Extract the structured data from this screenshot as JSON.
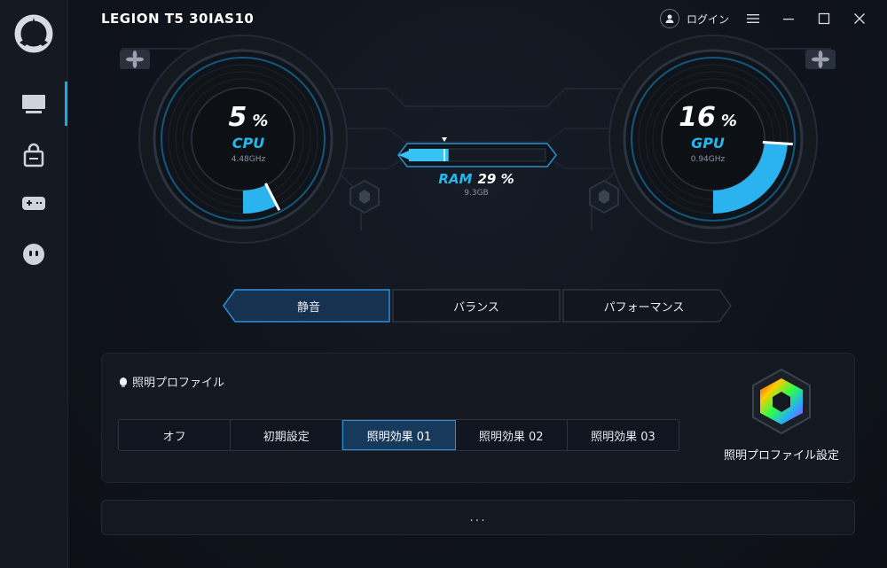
{
  "app": {
    "title": "LEGION T5 30IAS10"
  },
  "topbar": {
    "login_label": "ログイン"
  },
  "gauges": {
    "cpu": {
      "value": "5",
      "unit": "%",
      "label": "CPU",
      "freq": "4.48GHz",
      "percent": 5
    },
    "gpu": {
      "value": "16",
      "unit": "%",
      "label": "GPU",
      "freq": "0.94GHz",
      "percent": 16
    },
    "ram": {
      "label": "RAM",
      "value": "29 %",
      "size": "9.3GB",
      "percent": 29
    }
  },
  "modes": {
    "items": [
      "静音",
      "バランス",
      "パフォーマンス"
    ],
    "selected": "静音"
  },
  "lighting": {
    "title": "照明プロファイル",
    "tabs": [
      "オフ",
      "初期設定",
      "照明効果 01",
      "照明効果 02",
      "照明効果 03"
    ],
    "selected": "照明効果 01",
    "settings_label": "照明プロファイル設定"
  },
  "more": {
    "label": "..."
  },
  "colors": {
    "accent": "#22b8f0",
    "background": "#0e1117",
    "sidebar": "#151922"
  },
  "icons": {
    "sidebar": [
      "monitor-icon",
      "shopping-bag-icon",
      "gamepad-icon",
      "robot-face-icon"
    ],
    "topbar": [
      "user-icon",
      "menu-icon",
      "minimize-icon",
      "maximize-icon",
      "close-icon"
    ]
  }
}
